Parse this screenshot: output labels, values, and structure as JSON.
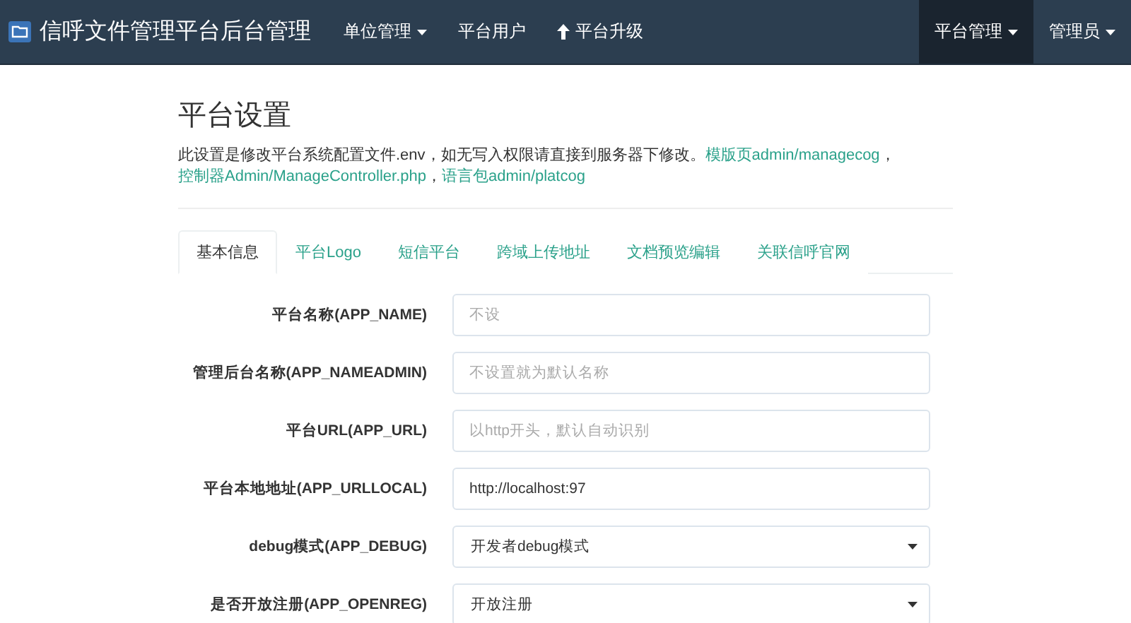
{
  "navbar": {
    "brand": "信呼文件管理平台后台管理",
    "left_items": [
      {
        "label": "单位管理",
        "kind": "dropdown",
        "selected": false
      },
      {
        "label": "平台用户",
        "kind": "link",
        "selected": false
      },
      {
        "label": "平台升级",
        "kind": "upgrade",
        "selected": false
      }
    ],
    "right_items": [
      {
        "label": "平台管理",
        "kind": "dropdown",
        "selected": true
      },
      {
        "label": "管理员",
        "kind": "dropdown",
        "selected": false
      }
    ]
  },
  "page": {
    "title": "平台设置",
    "description": {
      "text": "此设置是修改平台系统配置文件.env，如无写入权限请直接到服务器下修改。",
      "links": [
        {
          "text": "模版页admin/managecog",
          "sep": "，"
        },
        {
          "text": "控制器Admin/ManageController.php",
          "sep": "，"
        },
        {
          "text": "语言包admin/platcog"
        }
      ]
    }
  },
  "tabs": [
    {
      "label": "基本信息",
      "selected": true
    },
    {
      "label": "平台Logo",
      "selected": false
    },
    {
      "label": "短信平台",
      "selected": false
    },
    {
      "label": "跨域上传地址",
      "selected": false
    },
    {
      "label": "文档预览编辑",
      "selected": false
    },
    {
      "label": "关联信呼官网",
      "selected": false
    }
  ],
  "form": [
    {
      "kind": "text",
      "label": "平台名称(APP_NAME)",
      "placeholder": "不设"
    },
    {
      "kind": "text",
      "label": "管理后台名称(APP_NAMEADMIN)",
      "placeholder": "不设置就为默认名称"
    },
    {
      "kind": "text",
      "label": "平台URL(APP_URL)",
      "placeholder": "以http开头，默认自动识别"
    },
    {
      "kind": "text",
      "label": "平台本地地址(APP_URLLOCAL)",
      "value": "http://localhost:97"
    },
    {
      "kind": "select",
      "label": "debug模式(APP_DEBUG)",
      "value": "开发者debug模式"
    },
    {
      "kind": "select",
      "label": "是否开放注册(APP_OPENREG)",
      "value": "开放注册"
    }
  ]
}
